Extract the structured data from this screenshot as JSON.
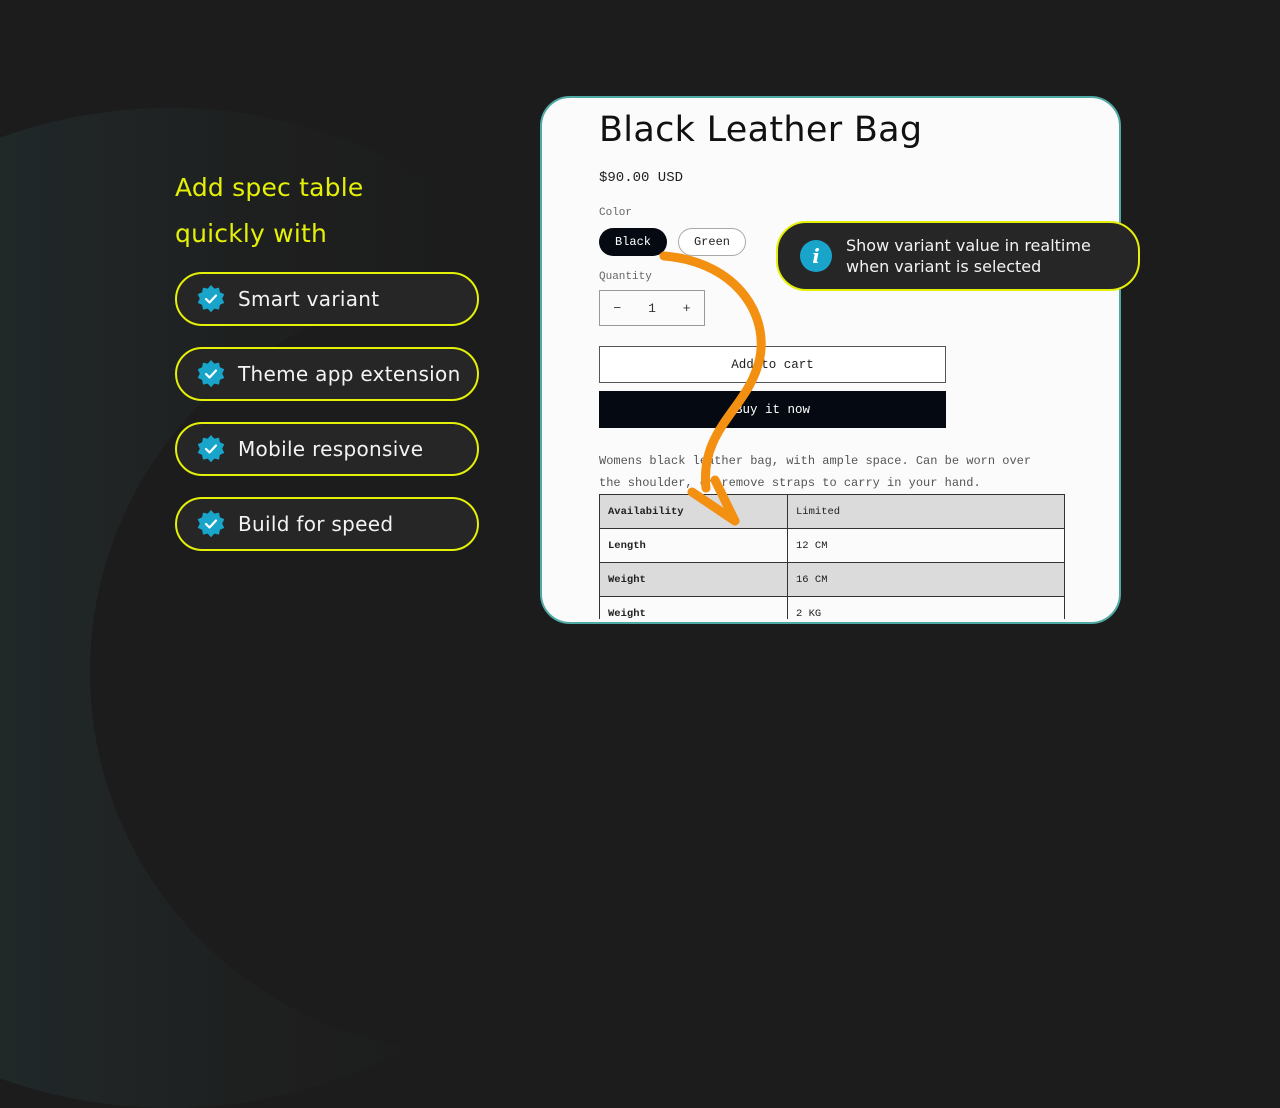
{
  "promo": {
    "headline_line1": "Add spec table",
    "headline_line2": "quickly with",
    "features": [
      {
        "label": "Smart variant",
        "icon": "verified-badge-icon"
      },
      {
        "label": "Theme app extension",
        "icon": "verified-badge-icon"
      },
      {
        "label": "Mobile responsive",
        "icon": "verified-badge-icon"
      },
      {
        "label": "Build for speed",
        "icon": "verified-badge-icon"
      }
    ],
    "tooltip": {
      "icon": "info-icon",
      "line1": "Show variant value in realtime",
      "line2": "when variant is selected"
    }
  },
  "colors": {
    "accent": "#e4f007",
    "badge": "#18a5c9",
    "card_border": "#4fa9a4",
    "arrow": "#f39012"
  },
  "product": {
    "title": "Black Leather Bag",
    "price": "$90.00 USD",
    "color_label": "Color",
    "colors": [
      "Black",
      "Green"
    ],
    "selected_color": "Black",
    "quantity_label": "Quantity",
    "quantity": "1",
    "decrement": "−",
    "increment": "+",
    "add_to_cart": "Add to cart",
    "buy_now": "Buy it now",
    "description_line1": "Womens black leather bag, with ample space. Can be worn over",
    "description_line2": "the shoulder, or remove straps to carry in your hand.",
    "spec_table": [
      {
        "key": "Availability",
        "value": "Limited"
      },
      {
        "key": "Length",
        "value": "12 CM"
      },
      {
        "key": "Weight",
        "value": "16 CM"
      },
      {
        "key": "Weight",
        "value": "2 KG"
      }
    ]
  }
}
